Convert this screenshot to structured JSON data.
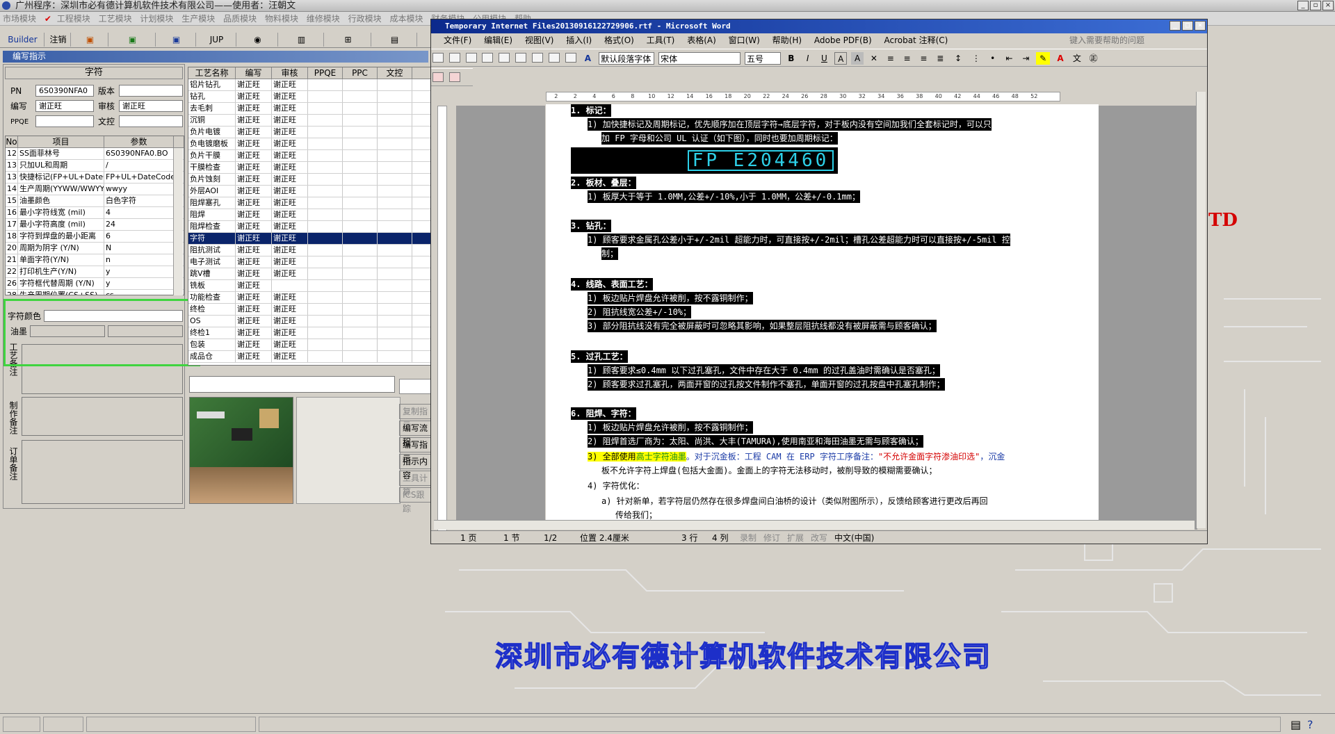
{
  "app": {
    "title": "广州程序：深圳市必有德计算机软件技术有限公司——使用者：汪朝文",
    "menu": [
      "市场模块",
      "工程模块",
      "工艺模块",
      "计划模块",
      "生产模块",
      "品质模块",
      "物料模块",
      "维修模块",
      "行政模块",
      "成本模块",
      "财务模块",
      "公用模块",
      "帮助"
    ],
    "active_menu": "工程模块",
    "toolbar": [
      "Builder",
      "注销",
      "JUP"
    ]
  },
  "panel": {
    "title": "编写指示",
    "header": "字符",
    "fields": {
      "pn_label": "PN",
      "pn_value": "6S0390NFA0",
      "version_label": "版本",
      "version_value": "",
      "author_label": "编写",
      "author_value": "谢正旺",
      "review_label": "审核",
      "review_value": "谢正旺",
      "ppqe_label": "PPQE",
      "ppqe_value": "",
      "control_label": "文控",
      "control_value": ""
    },
    "params_headers": [
      "No",
      "项目",
      "参数"
    ],
    "params": [
      [
        "12",
        "SS面菲林号",
        "6S0390NFA0.BO"
      ],
      [
        "13",
        "只加UL和周期",
        "/"
      ],
      [
        "13",
        "快捷标记(FP+UL+DateCo",
        "FP+UL+DateCode"
      ],
      [
        "14",
        "生产周期(YYWW/WWYY)",
        "wwyy"
      ],
      [
        "15",
        "油墨颜色",
        "白色字符"
      ],
      [
        "16",
        "最小字符线宽 (mil)",
        "4"
      ],
      [
        "17",
        "最小字符高度 (mil)",
        "24"
      ],
      [
        "18",
        "字符到焊盘的最小距离",
        "6"
      ],
      [
        "20",
        "周期为阴字 (Y/N)",
        "N"
      ],
      [
        "21",
        "单面字符(Y/N)",
        "n"
      ],
      [
        "22",
        "打印机生产(Y/N)",
        "y"
      ],
      [
        "26",
        "字符框代替周期 (Y/N)",
        "y"
      ],
      [
        "28",
        "生产周期位置(CS+SS)",
        "cs"
      ]
    ],
    "color_label": "字符颜色",
    "ink_label": "油墨",
    "note_labels": [
      "工艺备注",
      "制作备注",
      "订单备注"
    ]
  },
  "process": {
    "headers": [
      "工艺名称",
      "编写",
      "审核",
      "PPQE",
      "PPC",
      "文控"
    ],
    "rows": [
      [
        "铝片钻孔",
        "谢正旺",
        "谢正旺"
      ],
      [
        "钻孔",
        "谢正旺",
        "谢正旺"
      ],
      [
        "去毛刺",
        "谢正旺",
        "谢正旺"
      ],
      [
        "沉铜",
        "谢正旺",
        "谢正旺"
      ],
      [
        "负片电镀",
        "谢正旺",
        "谢正旺"
      ],
      [
        "负电镀磨板",
        "谢正旺",
        "谢正旺"
      ],
      [
        "负片干膜",
        "谢正旺",
        "谢正旺"
      ],
      [
        "干膜检查",
        "谢正旺",
        "谢正旺"
      ],
      [
        "负片蚀刻",
        "谢正旺",
        "谢正旺"
      ],
      [
        "外层AOI",
        "谢正旺",
        "谢正旺"
      ],
      [
        "阻焊塞孔",
        "谢正旺",
        "谢正旺"
      ],
      [
        "阻焊",
        "谢正旺",
        "谢正旺"
      ],
      [
        "阻焊检查",
        "谢正旺",
        "谢正旺"
      ],
      [
        "字符",
        "谢正旺",
        "谢正旺"
      ],
      [
        "阻抗测试",
        "谢正旺",
        "谢正旺"
      ],
      [
        "电子测试",
        "谢正旺",
        "谢正旺"
      ],
      [
        "跳V槽",
        "谢正旺",
        "谢正旺"
      ],
      [
        "铣板",
        "谢正旺",
        ""
      ],
      [
        "功能检查",
        "谢正旺",
        "谢正旺"
      ],
      [
        "终检",
        "谢正旺",
        "谢正旺"
      ],
      [
        "OS",
        "谢正旺",
        "谢正旺"
      ],
      [
        "终检1",
        "谢正旺",
        "谢正旺"
      ],
      [
        "包装",
        "谢正旺",
        "谢正旺"
      ],
      [
        "成品仓",
        "谢正旺",
        "谢正旺"
      ]
    ],
    "selected_index": 13,
    "side_buttons": [
      "复制指示",
      "编写流程",
      "编写指示",
      "指示内容",
      "工具计算",
      "ICS跟踪"
    ]
  },
  "word": {
    "title": "Temporary Internet Files20130916122729906.rtf - Microsoft Word",
    "menu": [
      "文件(F)",
      "编辑(E)",
      "视图(V)",
      "插入(I)",
      "格式(O)",
      "工具(T)",
      "表格(A)",
      "窗口(W)",
      "帮助(H)",
      "Adobe PDF(B)",
      "Acrobat 注释(C)"
    ],
    "help_placeholder": "键入需要帮助的问题",
    "style_value": "默认段落字体",
    "font_value": "宋体",
    "size_value": "五号",
    "ruler_numbers": [
      "2",
      "2",
      "4",
      "6",
      "8",
      "10",
      "12",
      "14",
      "16",
      "18",
      "20",
      "22",
      "24",
      "26",
      "28",
      "30",
      "32",
      "34",
      "36",
      "38",
      "40",
      "42",
      "44",
      "46",
      "48",
      "52"
    ],
    "marking_image_text": "FP E204460",
    "doc": [
      "1.  标记：",
      "1) 加快捷标记及周期标记，优先顺序加在顶层字符→底层字符，对于板内没有空间加我们全套标记时，可以只",
      "加 FP 字母和公司 UL 认证（如下图），同时也要加周期标记：",
      "2.  板材、叠层：",
      "1) 板厚大于等于 1.0MM,公差+/-10%,小于 1.0MM，公差+/-0.1mm；",
      "3.  钻孔：",
      "1) 顾客要求金属孔公差小于+/-2mil 超能力时，可直接按+/-2mil；槽孔公差超能力时可以直接按+/-5mil 控",
      "制；",
      "4.  线路、表面工艺：",
      "1) 板边贴片焊盘允许被削，按不露铜制作；",
      "2) 阻抗线宽公差+/-10%；",
      "3) 部分阻抗线没有完全被屏蔽时可忽略其影响，如果整层阻抗线都没有被屏蔽需与顾客确认；",
      "5.  过孔工艺：",
      "1) 顾客要求≤0.4mm 以下过孔塞孔，文件中存在大于 0.4mm 的过孔盖油时需确认是否塞孔；",
      "2) 顾客要求过孔塞孔，两面开窗的过孔按文件制作不塞孔，单面开窗的过孔按盘中孔塞孔制作；",
      "6.  阻焊、字符：",
      "1) 板边贴片焊盘允许被削，按不露铜制作；",
      "2) 阻焊首选厂商为：太阳、尚洪、大丰(TAMURA),使用南亚和海田油墨无需与顾客确认；",
      "3) 全部使用",
      "高士字符油墨",
      "。对于沉金板：工程 CAM 在 ERP 字符工序备注：",
      "\"不允许金面字符渗油印选\"",
      "，沉金",
      "板不允许字符上焊盘(包括大金面)。金面上的字符无法移动时，被削导致的模糊需要确认；",
      "4) 字符优化：",
      "a) 针对新单，若字符层仍然存在很多焊盘间白油桥的设计（类似附图所示），反馈给顾客进行更改后再回",
      "传给我们；"
    ],
    "status": {
      "page": "1 页",
      "section": "1 节",
      "pages": "1/2",
      "pos": "位置 2.4厘米",
      "line": "3 行",
      "col": "4 列",
      "rec": "录制",
      "rev": "修订",
      "ext": "扩展",
      "ovr": "改写",
      "lang": "中文(中国)"
    }
  },
  "background": {
    "company": "深圳市必有德计算机软件技术有限公司",
    "ltd_fragment": "TD"
  },
  "colors": {
    "title_blue": "#0c2a8c",
    "selection": "#0a246a",
    "highlight_green": "#3fd43f",
    "doc_red": "#d40000",
    "company_blue": "#1d2fc9"
  }
}
